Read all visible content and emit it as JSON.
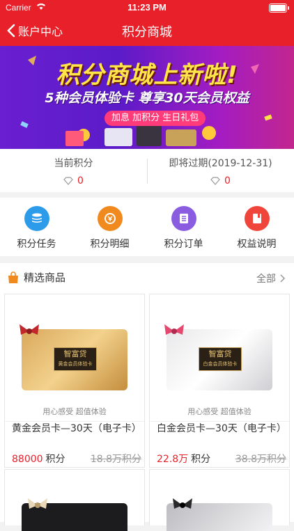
{
  "status": {
    "carrier": "Carrier",
    "time": "11:23 PM"
  },
  "navbar": {
    "back_label": "账户中心",
    "title": "积分商城"
  },
  "banner": {
    "headline": "积分商城上新啦!",
    "subhead": "5种会员体验卡 尊享30天会员权益",
    "pill": "加息 加积分 生日礼包"
  },
  "points": {
    "current_label": "当前积分",
    "current_value": "0",
    "expiring_label": "即将过期(2019-12-31)",
    "expiring_value": "0"
  },
  "actions": [
    {
      "label": "积分任务",
      "icon": "database-icon",
      "color": "#2b9bea"
    },
    {
      "label": "积分明细",
      "icon": "coin-icon",
      "color": "#f08a1e"
    },
    {
      "label": "积分订单",
      "icon": "document-icon",
      "color": "#8a5ce0"
    },
    {
      "label": "权益说明",
      "icon": "book-icon",
      "color": "#f0453a"
    }
  ],
  "section": {
    "title": "精选商品",
    "all_label": "全部"
  },
  "products": [
    {
      "name": "黄金会员卡—30天（电子卡）",
      "tagline": "用心感受 超值体验",
      "price": "88000",
      "unit": "积分",
      "old_price": "18.8万积分",
      "card_logo": "智富贷",
      "card_subtitle": "黄金会员体验卡"
    },
    {
      "name": "白金会员卡—30天（电子卡）",
      "tagline": "用心感受 超值体验",
      "price": "22.8万",
      "unit": "积分",
      "old_price": "38.8万积分",
      "card_logo": "智富贷",
      "card_subtitle": "白金会员体验卡"
    }
  ]
}
